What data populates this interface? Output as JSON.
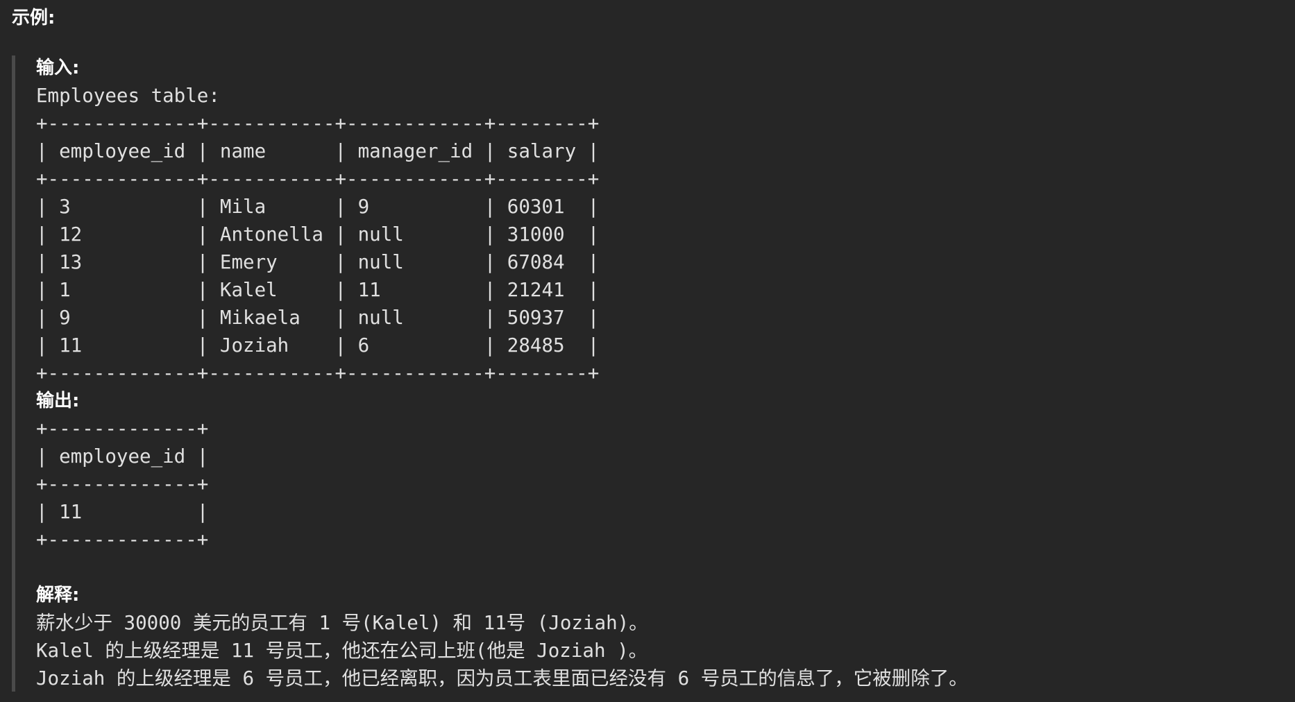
{
  "heading": "示例:",
  "input_label": "输入:",
  "input_lines": [
    "Employees table:",
    "+-------------+-----------+------------+--------+",
    "| employee_id | name      | manager_id | salary |",
    "+-------------+-----------+------------+--------+",
    "| 3           | Mila      | 9          | 60301  |",
    "| 12          | Antonella | null       | 31000  |",
    "| 13          | Emery     | null       | 67084  |",
    "| 1           | Kalel     | 11         | 21241  |",
    "| 9           | Mikaela   | null       | 50937  |",
    "| 11          | Joziah    | 6          | 28485  |",
    "+-------------+-----------+------------+--------+"
  ],
  "output_label": "输出:",
  "output_lines": [
    "+-------------+",
    "| employee_id |",
    "+-------------+",
    "| 11          |",
    "+-------------+"
  ],
  "explanation_label": "解释:",
  "explanation_lines": [
    "薪水少于 30000 美元的员工有 1 号(Kalel) 和 11号 (Joziah)。",
    "Kalel 的上级经理是 11 号员工，他还在公司上班(他是 Joziah )。",
    "Joziah 的上级经理是 6 号员工，他已经离职，因为员工表里面已经没有 6 号员工的信息了，它被删除了。"
  ]
}
